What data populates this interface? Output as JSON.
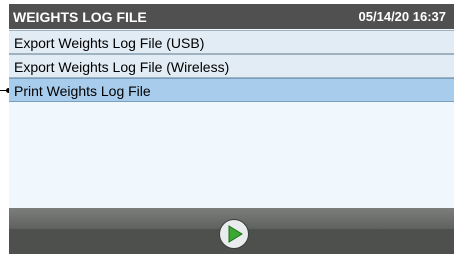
{
  "header": {
    "title": "WEIGHTS LOG FILE",
    "datetime": "05/14/20 16:37"
  },
  "menu": {
    "items": [
      {
        "label": "Export Weights Log File (USB)",
        "selected": false
      },
      {
        "label": "Export Weights Log File (Wireless)",
        "selected": false
      },
      {
        "label": "Print Weights Log File",
        "selected": true
      }
    ]
  },
  "footer": {
    "play_icon": "play-icon",
    "accent_color": "#3aa832"
  }
}
